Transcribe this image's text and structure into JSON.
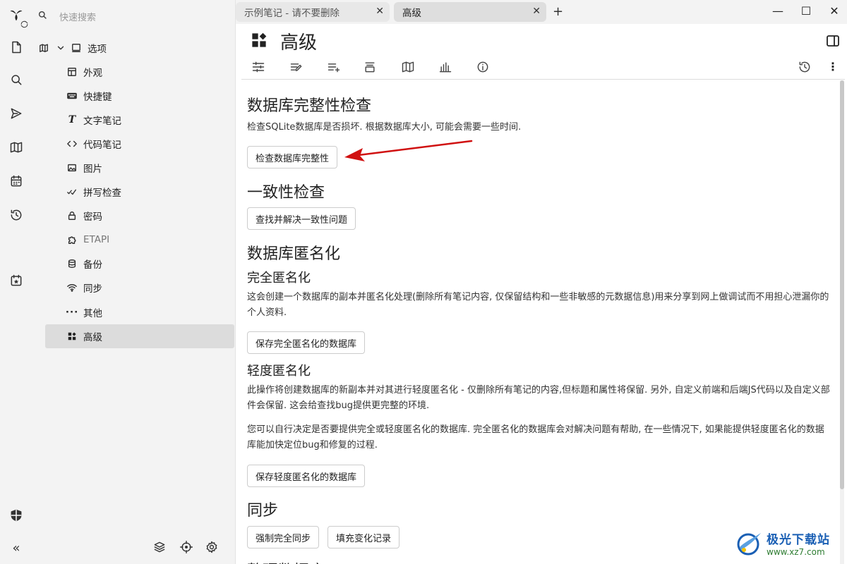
{
  "search": {
    "placeholder": "快速搜索"
  },
  "tree": {
    "root_label": "选项",
    "items": [
      {
        "label": "外观",
        "icon": "layout-icon"
      },
      {
        "label": "快捷键",
        "icon": "keyboard-icon"
      },
      {
        "label": "文字笔记",
        "icon": "text-icon"
      },
      {
        "label": "代码笔记",
        "icon": "code-icon"
      },
      {
        "label": "图片",
        "icon": "image-icon"
      },
      {
        "label": "拼写检查",
        "icon": "spellcheck-icon"
      },
      {
        "label": "密码",
        "icon": "lock-icon"
      },
      {
        "label": "ETAPI",
        "icon": "extension-icon"
      },
      {
        "label": "备份",
        "icon": "database-icon"
      },
      {
        "label": "同步",
        "icon": "wifi-icon"
      },
      {
        "label": "其他",
        "icon": "dots-icon"
      },
      {
        "label": "高级",
        "icon": "grid-icon"
      }
    ]
  },
  "tabs": [
    {
      "label": "示例笔记 - 请不要删除"
    },
    {
      "label": "高级"
    }
  ],
  "note": {
    "title": "高级"
  },
  "sections": {
    "integrity": {
      "title": "数据库完整性检查",
      "desc": "检查SQLite数据库是否损坏. 根据数据库大小, 可能会需要一些时间.",
      "button": "检查数据库完整性"
    },
    "consistency": {
      "title": "一致性检查",
      "button": "查找并解决一致性问题"
    },
    "anonymize": {
      "title": "数据库匿名化",
      "full_title": "完全匿名化",
      "full_desc": "这会创建一个数据库的副本并匿名化处理(删除所有笔记内容, 仅保留结构和一些非敏感的元数据信息)用来分享到网上做调试而不用担心泄漏你的个人资料.",
      "full_button": "保存完全匿名化的数据库",
      "light_title": "轻度匿名化",
      "light_desc": "此操作将创建数据库的新副本并对其进行轻度匿名化 - 仅删除所有笔记的内容,但标题和属性将保留. 另外, 自定义前端和后端JS代码以及自定义部件会保留. 这会给查找bug提供更完整的环境.",
      "choice_desc": "您可以自行决定是否要提供完全或轻度匿名化的数据库. 完全匿名化的数据库会对解决问题有帮助, 在一些情况下, 如果能提供轻度匿名化的数据库能加快定位bug和修复的过程.",
      "light_button": "保存轻度匿名化的数据库"
    },
    "sync": {
      "title": "同步",
      "force_button": "强制完全同步",
      "fill_button": "填充变化记录"
    },
    "partial_next": {
      "title": "整理数据库"
    }
  },
  "watermark": {
    "name": "极光下载站",
    "url": "www.xz7.com"
  },
  "colors": {
    "arrow": "#d01010",
    "active_bg": "#dcdcdc"
  }
}
